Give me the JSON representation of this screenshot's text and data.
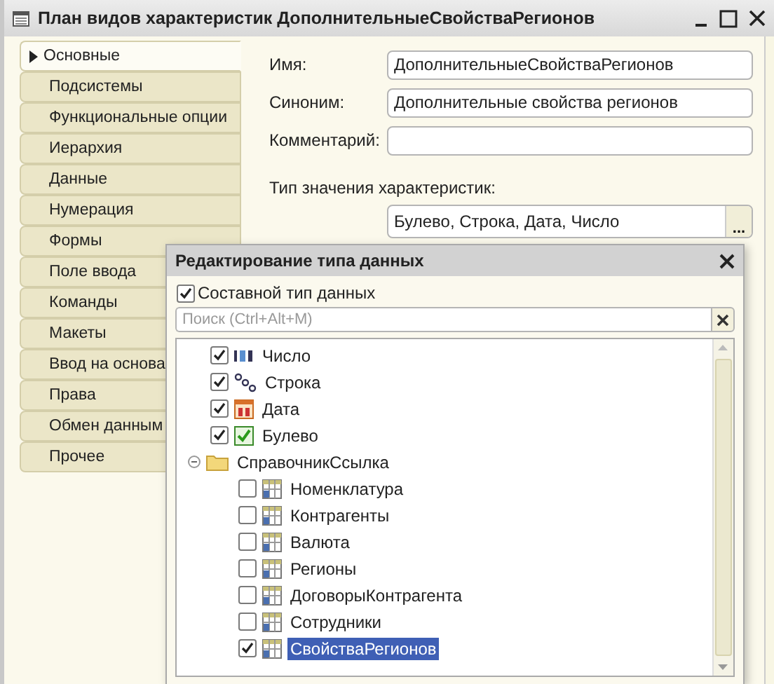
{
  "window": {
    "title": "План видов характеристик ДополнительныеСвойстваРегионов"
  },
  "tabs": [
    {
      "label": "Основные",
      "selected": true
    },
    {
      "label": "Подсистемы",
      "selected": false
    },
    {
      "label": "Функциональные опции",
      "selected": false
    },
    {
      "label": "Иерархия",
      "selected": false
    },
    {
      "label": "Данные",
      "selected": false
    },
    {
      "label": "Нумерация",
      "selected": false
    },
    {
      "label": "Формы",
      "selected": false
    },
    {
      "label": "Поле ввода",
      "selected": false
    },
    {
      "label": "Команды",
      "selected": false
    },
    {
      "label": "Макеты",
      "selected": false
    },
    {
      "label": "Ввод на основа",
      "selected": false
    },
    {
      "label": "Права",
      "selected": false
    },
    {
      "label": "Обмен данным",
      "selected": false
    },
    {
      "label": "Прочее",
      "selected": false
    }
  ],
  "form": {
    "fields": [
      {
        "label": "Имя:",
        "value": "ДополнительныеСвойстваРегионов"
      },
      {
        "label": "Синоним:",
        "value": "Дополнительные свойства регионов"
      },
      {
        "label": "Комментарий:"
      }
    ],
    "type_label": "Тип значения характеристик:",
    "type_value": "Булево, Строка, Дата, Число",
    "type_button": "..."
  },
  "dialog": {
    "title": "Редактирование типа данных",
    "composite": {
      "label": "Составной тип данных",
      "checked": true
    },
    "search": {
      "placeholder": "Поиск (Ctrl+Alt+M)"
    },
    "tree": [
      {
        "label": "Число",
        "kind": "number",
        "checked": true,
        "selected": false
      },
      {
        "label": "Строка",
        "kind": "string",
        "checked": true,
        "selected": false
      },
      {
        "label": "Дата",
        "kind": "date",
        "checked": true,
        "selected": false
      },
      {
        "label": "Булево",
        "kind": "boolean",
        "checked": true,
        "selected": false
      },
      {
        "label": "СправочникСсылка",
        "kind": "folder",
        "expanded": true,
        "selected": false,
        "children": [
          {
            "label": "Номенклатура",
            "kind": "catalog",
            "checked": false,
            "selected": false
          },
          {
            "label": "Контрагенты",
            "kind": "catalog",
            "checked": false,
            "selected": false
          },
          {
            "label": "Валюта",
            "kind": "catalog",
            "checked": false,
            "selected": false
          },
          {
            "label": "Регионы",
            "kind": "catalog",
            "checked": false,
            "selected": false
          },
          {
            "label": "ДоговорыКонтрагента",
            "kind": "catalog",
            "checked": false,
            "selected": false
          },
          {
            "label": "Сотрудники",
            "kind": "catalog",
            "checked": false,
            "selected": false
          },
          {
            "label": "СвойстваРегионов",
            "kind": "catalog",
            "checked": true,
            "selected": true
          }
        ]
      }
    ]
  }
}
